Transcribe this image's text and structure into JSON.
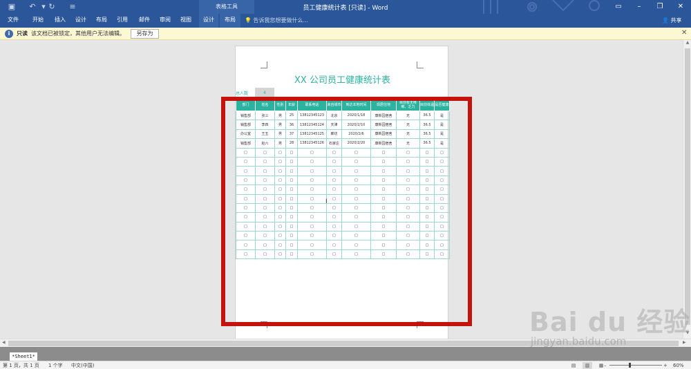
{
  "window": {
    "title": "员工健康统计表 [只读] - Word",
    "table_tools": "表格工具",
    "share": "共享"
  },
  "ribbon": {
    "tabs": [
      "文件",
      "开始",
      "插入",
      "设计",
      "布局",
      "引用",
      "邮件",
      "审阅",
      "视图",
      "设计",
      "布局"
    ],
    "tell_me": "告诉我您想要做什么..."
  },
  "readonly_bar": {
    "label": "只读",
    "message": "该文档已被锁定，其他用户无法编辑。",
    "button": "另存为"
  },
  "document": {
    "title": "XX 公司员工健康统计表",
    "total_label": "总人数",
    "total_value": "4",
    "headers": [
      "部门",
      "姓名",
      "性别",
      "年龄",
      "联系电话",
      "来自城市",
      "到达本地时间",
      "现居住地",
      "目前有无咳嗽、乏力",
      "目前体温",
      "是否健康"
    ],
    "rows": [
      [
        "销售部",
        "张三",
        "男",
        "25",
        "13812345123",
        "北京",
        "2020/1/18",
        "康新园宿舍",
        "无",
        "36.5",
        "是"
      ],
      [
        "销售部",
        "李四",
        "男",
        "36",
        "13812345124",
        "天津",
        "2020/2/10",
        "康新园宿舍",
        "无",
        "36.5",
        "是"
      ],
      [
        "办公室",
        "王五",
        "男",
        "37",
        "13812345125",
        "廊坊",
        "2020/2/6",
        "康新园宿舍",
        "无",
        "36.5",
        "是"
      ],
      [
        "销售部",
        "赵六",
        "男",
        "28",
        "13812345126",
        "石家庄",
        "2020/2/20",
        "康新园宿舍",
        "无",
        "36.5",
        "是"
      ]
    ],
    "empty_cell": "□",
    "empty_rows": 12
  },
  "sheet_tab": "Sheet1",
  "status": {
    "page": "第 1 页，共 1 页",
    "words": "1 个字",
    "lang": "中文(中国)",
    "zoom": "60%"
  },
  "watermark": {
    "brand": "Bai du 经验",
    "url": "jingyan.baidu.com"
  },
  "colors": {
    "accent": "#2bb3a0",
    "ribbon": "#2b579a",
    "highlight": "#c3130c"
  }
}
